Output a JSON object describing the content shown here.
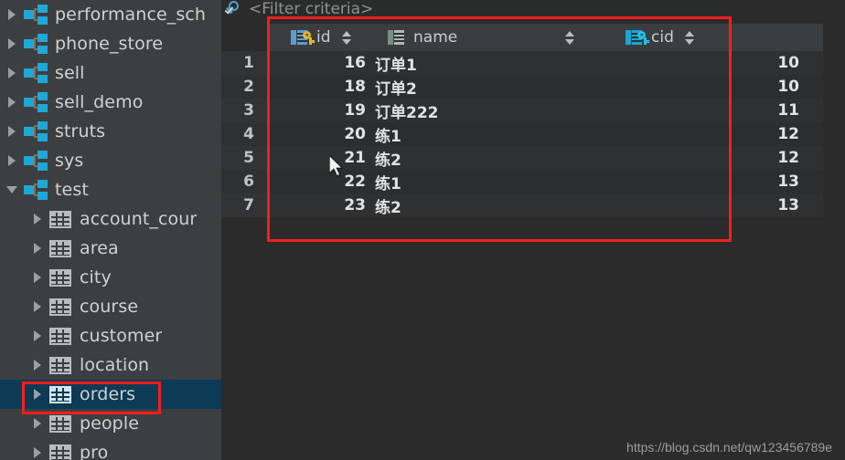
{
  "sidebar": {
    "items": [
      {
        "label": "performance_sch",
        "type": "schema",
        "expanded": false,
        "indent": 1,
        "selected": false
      },
      {
        "label": "phone_store",
        "type": "schema",
        "expanded": false,
        "indent": 1,
        "selected": false
      },
      {
        "label": "sell",
        "type": "schema",
        "expanded": false,
        "indent": 1,
        "selected": false
      },
      {
        "label": "sell_demo",
        "type": "schema",
        "expanded": false,
        "indent": 1,
        "selected": false
      },
      {
        "label": "struts",
        "type": "schema",
        "expanded": false,
        "indent": 1,
        "selected": false
      },
      {
        "label": "sys",
        "type": "schema",
        "expanded": false,
        "indent": 1,
        "selected": false
      },
      {
        "label": "test",
        "type": "schema",
        "expanded": true,
        "indent": 1,
        "selected": false
      },
      {
        "label": "account_cour",
        "type": "table",
        "expanded": false,
        "indent": 2,
        "selected": false
      },
      {
        "label": "area",
        "type": "table",
        "expanded": false,
        "indent": 2,
        "selected": false
      },
      {
        "label": "city",
        "type": "table",
        "expanded": false,
        "indent": 2,
        "selected": false
      },
      {
        "label": "course",
        "type": "table",
        "expanded": false,
        "indent": 2,
        "selected": false
      },
      {
        "label": "customer",
        "type": "table",
        "expanded": false,
        "indent": 2,
        "selected": false
      },
      {
        "label": "location",
        "type": "table",
        "expanded": false,
        "indent": 2,
        "selected": false
      },
      {
        "label": "orders",
        "type": "table",
        "expanded": false,
        "indent": 2,
        "selected": true
      },
      {
        "label": "people",
        "type": "table",
        "expanded": false,
        "indent": 2,
        "selected": false
      },
      {
        "label": "pro",
        "type": "table",
        "expanded": false,
        "indent": 2,
        "selected": false
      }
    ]
  },
  "filter": {
    "icon": "filter-search-icon",
    "placeholder": "<Filter criteria>"
  },
  "grid": {
    "columns": [
      {
        "name": "id",
        "icon": "primary-key-column-icon",
        "sortable": true
      },
      {
        "name": "name",
        "icon": "text-column-icon",
        "sortable": true
      },
      {
        "name": "cid",
        "icon": "foreign-key-column-icon",
        "sortable": true
      }
    ],
    "row_numbers": [
      "1",
      "2",
      "3",
      "4",
      "5",
      "6",
      "7"
    ],
    "rows": [
      {
        "id": "16",
        "name": "订单1",
        "cid": "10"
      },
      {
        "id": "18",
        "name": "订单2",
        "cid": "10"
      },
      {
        "id": "19",
        "name": "订单222",
        "cid": "11"
      },
      {
        "id": "20",
        "name": "练1",
        "cid": "12"
      },
      {
        "id": "21",
        "name": "练2",
        "cid": "12"
      },
      {
        "id": "22",
        "name": "练1",
        "cid": "13"
      },
      {
        "id": "23",
        "name": "练2",
        "cid": "13"
      }
    ]
  },
  "annotations": {
    "table_box": "red-highlight-rectangle",
    "orders_box": "red-highlight-rectangle"
  },
  "watermark": {
    "text": "https://blog.csdn.net/qw123456789e"
  },
  "colors": {
    "accent_red": "#f81d1d",
    "selection_blue": "#0d3a55",
    "schema_icon": "#1fa8d6",
    "pk_key": "#e8b426",
    "fk_key": "#1fc0ea"
  }
}
